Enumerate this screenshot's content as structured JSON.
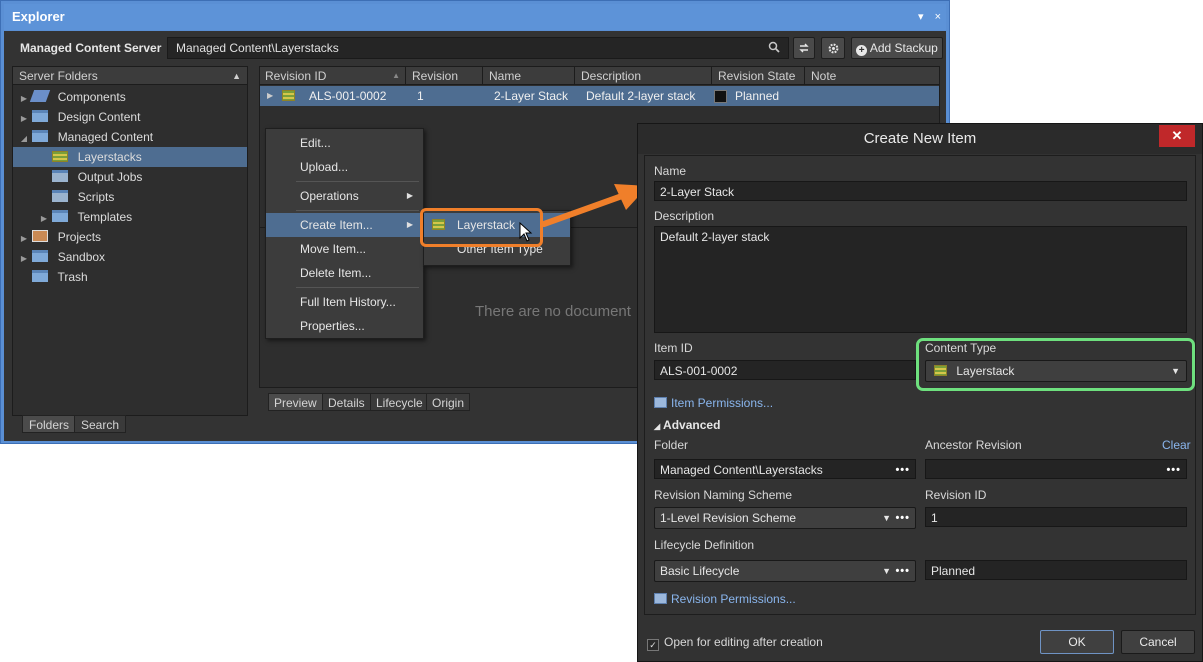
{
  "explorer": {
    "title": "Explorer",
    "title_controls": [
      "▾",
      "×"
    ],
    "server_select": "Managed Content Server ▾",
    "path": "Managed Content\\Layerstacks",
    "add_stackup": "Add Stackup",
    "folders_header": "Server Folders",
    "folders": [
      {
        "label": "Components",
        "arrow": "▶"
      },
      {
        "label": "Design Content",
        "arrow": "▶"
      },
      {
        "label": "Managed Content",
        "arrow": "◢"
      },
      {
        "label": "Layerstacks",
        "arrow": ""
      },
      {
        "label": "Output Jobs",
        "arrow": ""
      },
      {
        "label": "Scripts",
        "arrow": ""
      },
      {
        "label": "Templates",
        "arrow": "▶"
      },
      {
        "label": "Projects",
        "arrow": "▶"
      },
      {
        "label": "Sandbox",
        "arrow": "▶"
      },
      {
        "label": "Trash",
        "arrow": ""
      }
    ],
    "panel_tabs": [
      "Folders",
      "Search"
    ],
    "columns": [
      "Revision ID",
      "Revision",
      "Name",
      "Description",
      "Revision State",
      "Note"
    ],
    "row": {
      "revision_id": "ALS-001-0002",
      "revision": "1",
      "name": "2-Layer Stack",
      "description": "Default 2-layer stack",
      "state": "Planned"
    },
    "empty_message": "There are no document",
    "detail_tabs": [
      "Preview",
      "Details",
      "Lifecycle",
      "Origin"
    ]
  },
  "context_menu": {
    "items": [
      "Edit...",
      "Upload...",
      "Operations",
      "Create Item...",
      "Move Item...",
      "Delete Item...",
      "Full Item History...",
      "Properties..."
    ]
  },
  "submenu": {
    "items": [
      "Layerstack",
      "Other Item Type"
    ]
  },
  "dialog": {
    "title": "Create New Item",
    "close": "✕",
    "name_label": "Name",
    "name_value": "2-Layer Stack",
    "description_label": "Description",
    "description_value": "Default 2-layer stack",
    "item_id_label": "Item ID",
    "item_id_value": "ALS-001-0002",
    "content_type_label": "Content Type",
    "content_type_value": "Layerstack",
    "item_permissions": "Item Permissions...",
    "advanced": "Advanced",
    "folder_label": "Folder",
    "folder_value": "Managed Content\\Layerstacks",
    "ancestor_label": "Ancestor Revision",
    "clear": "Clear",
    "naming_label": "Revision Naming Scheme",
    "naming_value": "1-Level Revision Scheme",
    "revision_id_label": "Revision ID",
    "revision_id_value": "1",
    "lifecycle_label": "Lifecycle Definition",
    "lifecycle_value": "Basic Lifecycle",
    "lifecycle_state": "Planned",
    "revision_permissions": "Revision Permissions...",
    "open_for_editing": "Open for editing after creation",
    "ok": "OK",
    "cancel": "Cancel"
  },
  "colors": {
    "callout_orange": "#f07f2a",
    "callout_green": "#6ee07e",
    "selection": "#4e6d91",
    "title_blue": "#5d93d8"
  }
}
